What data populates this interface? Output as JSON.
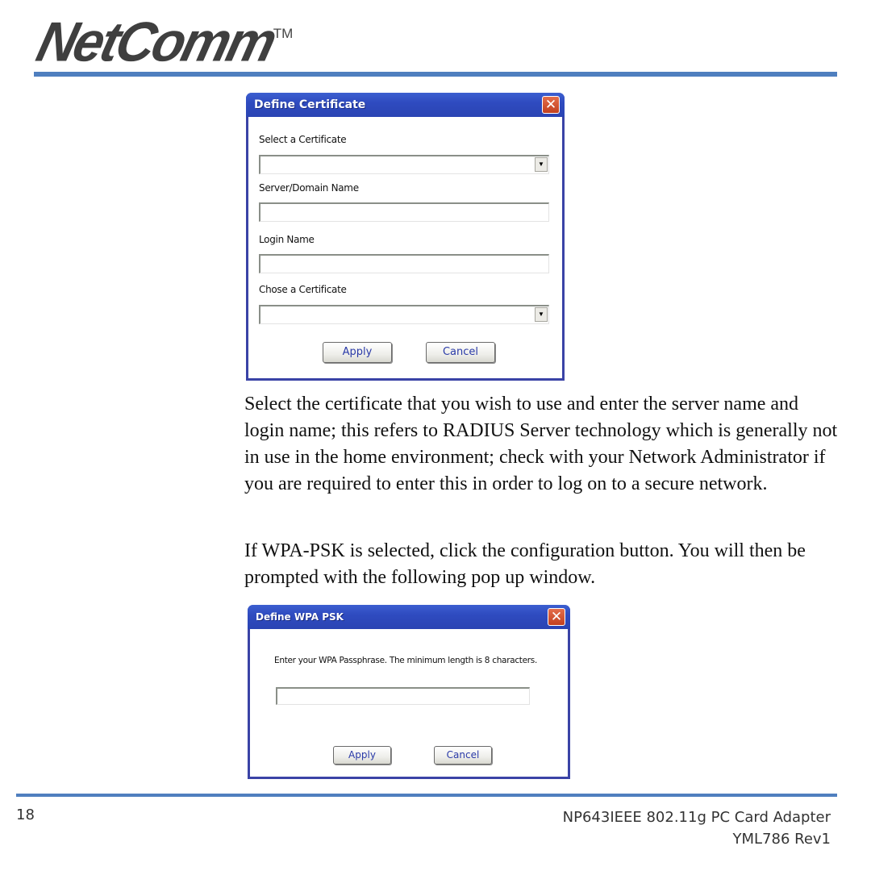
{
  "header": {
    "logo_text": "NetComm",
    "logo_tm": "TM"
  },
  "dialog_certificate": {
    "title": "Define Certificate",
    "close_icon": "close-icon",
    "fields": [
      {
        "label": "Select a Certificate",
        "type": "select",
        "value": ""
      },
      {
        "label": "Server/Domain Name",
        "type": "text",
        "value": ""
      },
      {
        "label": "Login Name",
        "type": "text",
        "value": ""
      },
      {
        "label": "Chose a Certificate",
        "type": "select",
        "value": ""
      }
    ],
    "apply_label": "Apply",
    "cancel_label": "Cancel"
  },
  "paragraphs": [
    "Select the certificate that you wish to use and enter the server name and login name; this refers to RADIUS Server technology which is generally not in use in the home environment; check with your Network Administrator if you are required to enter this in order to log on to a secure network.",
    "If WPA-PSK is selected, click the configuration button.  You will then be prompted with the following pop up window."
  ],
  "dialog_wpa": {
    "title": "Define WPA PSK",
    "prompt": "Enter your WPA Passphrase.  The minimum length is 8 characters.",
    "passphrase_value": "",
    "apply_label": "Apply",
    "cancel_label": "Cancel"
  },
  "footer": {
    "page_number": "18",
    "product_line1": "NP643IEEE 802.11g PC Card Adapter",
    "product_line2": "YML786 Rev1"
  },
  "colors": {
    "accent_rule": "#4f7fbf",
    "titlebar": "#2f4bc0",
    "close_button": "#d0502c",
    "button_text": "#2a3aa8"
  }
}
